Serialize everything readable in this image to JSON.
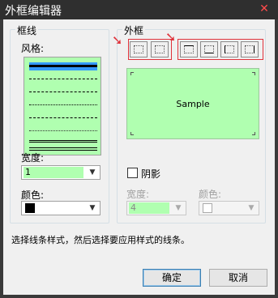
{
  "window": {
    "title": "外框编辑器",
    "close_glyph": "✕"
  },
  "line_group": {
    "title": "框线",
    "style_label": "风格:",
    "width_label": "宽度:",
    "width_value": "1",
    "color_label": "颜色:",
    "color_value": "#000000"
  },
  "frame_group": {
    "title": "外框",
    "preview_text": "Sample",
    "shadow_label": "阴影",
    "shadow_width_label": "宽度:",
    "shadow_width_value": "4",
    "shadow_color_label": "颜色:"
  },
  "hint": "选择线条样式，然后选择要应用样式的线条。",
  "buttons": {
    "ok": "确定",
    "cancel": "取消"
  },
  "colors": {
    "accent_red": "#e0323a",
    "preview_bg": "#b0ffb0",
    "selected_line": "#3399ff"
  }
}
